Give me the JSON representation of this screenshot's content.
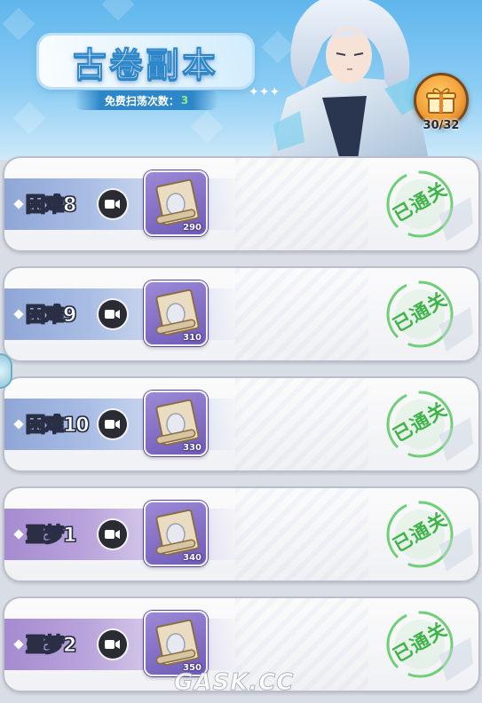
{
  "header": {
    "title": "古卷副本",
    "sweep_label": "免费扫荡次数：",
    "sweep_count": "3",
    "gift_progress": "30/32"
  },
  "stages": [
    {
      "name": "困难8",
      "tier": "hard",
      "reward_qty": "290",
      "status": "已通关"
    },
    {
      "name": "困难9",
      "tier": "hard",
      "reward_qty": "310",
      "status": "已通关"
    },
    {
      "name": "困难10",
      "tier": "hard",
      "reward_qty": "330",
      "status": "已通关"
    },
    {
      "name": "噩梦1",
      "tier": "nightmare",
      "reward_qty": "340",
      "status": "已通关"
    },
    {
      "name": "噩梦2",
      "tier": "nightmare",
      "reward_qty": "350",
      "status": "已通关"
    }
  ],
  "icons": {
    "video": "video-camera-icon",
    "reward": "scroll-icon",
    "gift": "gift-box-icon",
    "cleared": "cleared-stamp-icon"
  },
  "colors": {
    "hard_band": "#8fa6d6",
    "nightmare_band": "#a58bd0",
    "cleared_green": "#3fb34a",
    "banner_blue": "#5fb6ec",
    "sweep_count": "#8ff07c"
  },
  "watermark": "GASK.CC"
}
